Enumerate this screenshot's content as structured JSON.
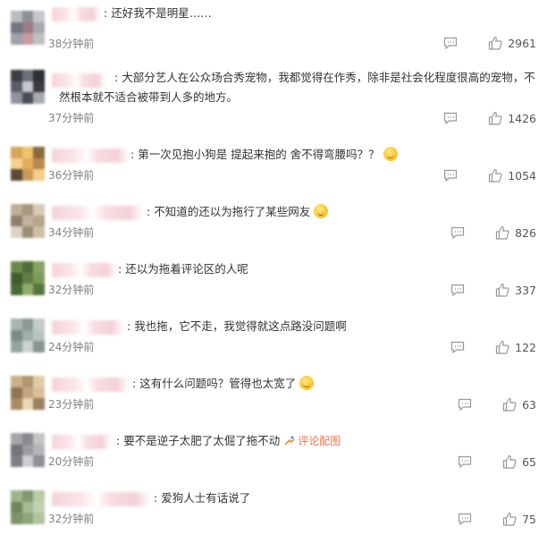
{
  "comments": [
    {
      "text": "还好我不是明星……",
      "time": "38分钟前",
      "likes": "2961",
      "avatar": [
        "#b9bcc0",
        "#8d8f95",
        "#c5c7ca",
        "#6f7680",
        "#9b7b80",
        "#a7a9ae",
        "#9da2a8",
        "#c69a9e",
        "#bfc2c5"
      ]
    },
    {
      "text": "大部分艺人在公众场合秀宠物，我都觉得在作秀，除非是社会化程度很高的宠物，不然根本就不适合被带到人多的地方。",
      "time": "37分钟前",
      "likes": "1426",
      "avatar": [
        "#3d3f45",
        "#6c6f77",
        "#2d2f35",
        "#5a5e68",
        "#c7c9cf",
        "#383a40",
        "#8f939b",
        "#4a4d55",
        "#a8abb0"
      ]
    },
    {
      "text": "第一次见抱小狗是 提起来抱的 舍不得弯腰吗？？",
      "time": "36分钟前",
      "likes": "1054",
      "avatar": [
        "#d9a35a",
        "#f0c26e",
        "#8a6a3e",
        "#f6d18c",
        "#e2ad5c",
        "#b88a4c",
        "#5b4a32",
        "#c99b58",
        "#f3cf87"
      ]
    },
    {
      "text": "不知道的还以为拖行了某些网友",
      "time": "34分钟前",
      "likes": "826",
      "avatar": [
        "#bfae98",
        "#a9987e",
        "#d8cbb8",
        "#8e7f6a",
        "#c3b49d",
        "#b5a58c",
        "#ddd3c4",
        "#9c8d77",
        "#cdbfa9"
      ]
    },
    {
      "text": "还以为拖着评论区的人呢",
      "time": "32分钟前",
      "likes": "337",
      "avatar": [
        "#6a8a4e",
        "#4f6f3a",
        "#86a463",
        "#3f5c2d",
        "#5f7f45",
        "#7b9a58",
        "#4a6a36",
        "#91ad6d",
        "#567640"
      ]
    },
    {
      "text": "我也拖，它不走，我觉得就这点路没问题啊",
      "time": "24分钟前",
      "likes": "122",
      "avatar": [
        "#a9b5b0",
        "#8c9a94",
        "#c3ccc8",
        "#7d8d86",
        "#9fb0a8",
        "#b8c4bf",
        "#94a49d",
        "#c9d2ce",
        "#86968f"
      ]
    },
    {
      "text": "这有什么问题吗？管得也太宽了",
      "time": "23分钟前",
      "likes": "63",
      "avatar": [
        "#c9b08a",
        "#b39470",
        "#e0cba8",
        "#8f7554",
        "#c4a57e",
        "#d6bf9a",
        "#a98a64",
        "#e8d6b6",
        "#9d7f5b"
      ]
    },
    {
      "text": "要不是逆子太肥了太倔了拖不动",
      "time": "20分钟前",
      "likes": "65",
      "pic_link": "评论配图",
      "avatar": [
        "#a7a5a8",
        "#8a8891",
        "#c6c4c7",
        "#74727a",
        "#9c9aa0",
        "#b6b4b9",
        "#7f7d86",
        "#d0ced2",
        "#908e96"
      ]
    },
    {
      "text": "爱狗人士有话说了",
      "time": "32分钟前",
      "likes": "75",
      "avatar": [
        "#9fb48c",
        "#82996f",
        "#b8caa6",
        "#6f865c",
        "#a6ba93",
        "#c2d2b2",
        "#7d9468",
        "#8fa67b",
        "#b1c49d"
      ]
    }
  ],
  "colors": {
    "time": "#808080",
    "link": "#eb7350",
    "icon": "#999999"
  }
}
